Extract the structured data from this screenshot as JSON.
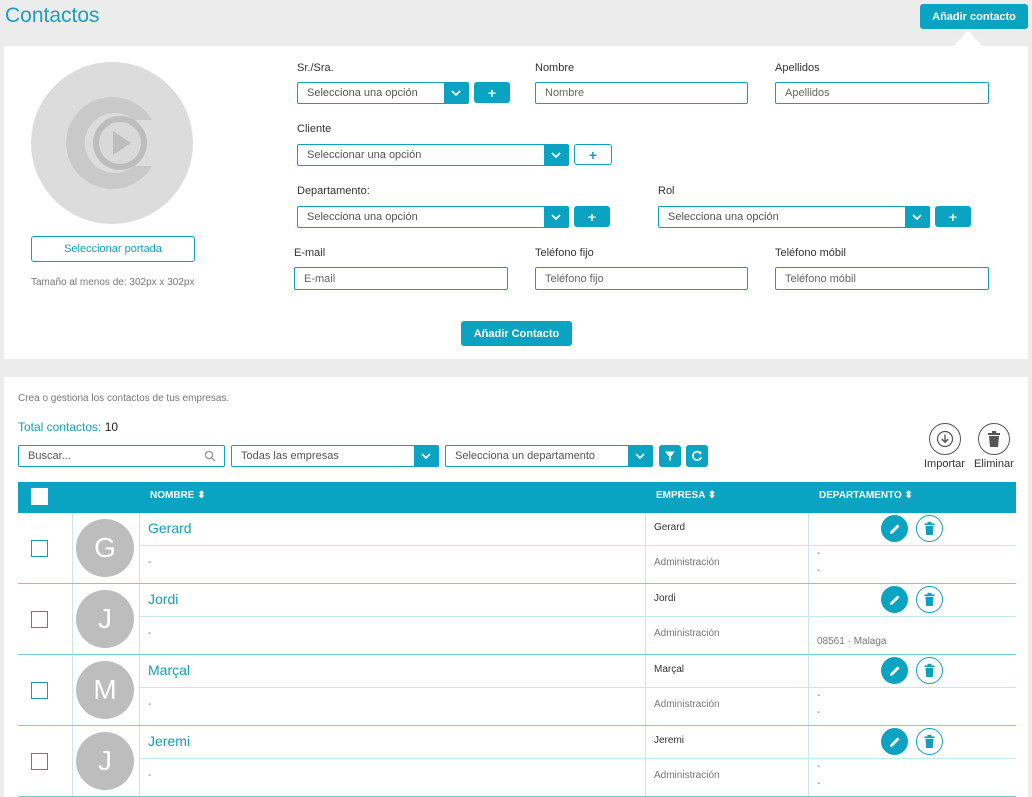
{
  "header": {
    "title": "Contactos",
    "add_button": "Añadir contacto"
  },
  "form": {
    "select_cover": "Seleccionar portada",
    "size_hint": "Tamaño al menos de: 302px x 302px",
    "salutation": {
      "label": "Sr./Sra.",
      "value": "Selecciona una opción"
    },
    "first_name": {
      "label": "Nombre",
      "placeholder": "Nombre"
    },
    "last_name": {
      "label": "Apellidos",
      "placeholder": "Apellidos"
    },
    "client": {
      "label": "Cliente",
      "value": "Seleccionar una opción"
    },
    "department": {
      "label": "Departamento:",
      "value": "Selecciona una opción"
    },
    "role": {
      "label": "Rol",
      "value": "Selecciona una opción"
    },
    "email": {
      "label": "E-mail",
      "placeholder": "E-mail"
    },
    "phone": {
      "label": "Teléfono fijo",
      "placeholder": "Teléfono fijo"
    },
    "mobile": {
      "label": "Teléfono móbil",
      "placeholder": "Teléfono móbil"
    },
    "plus": "+",
    "submit": "Añadir Contacto"
  },
  "list": {
    "description": "Crea o gestiona los contactos de tus empresas.",
    "total_label": "Total contactos:",
    "total_value": "10",
    "search_placeholder": "Buscar...",
    "company_filter": "Todas las empresas",
    "department_filter": "Selecciona un departamento",
    "import_label": "Importar",
    "delete_label": "Eliminar",
    "columns": {
      "name": "NOMBRE",
      "company": "EMPRESA",
      "department": "DEPARTAMENTO"
    },
    "rows": [
      {
        "initial": "G",
        "name": "Gerard",
        "detail": "-",
        "company": "Gerard",
        "dept": "Administración",
        "line1": "-",
        "line2": "-"
      },
      {
        "initial": "J",
        "name": "Jordi",
        "detail": "-",
        "company": "Jordi",
        "dept": "Administración",
        "line1": "",
        "line2": "08561 · Malaga"
      },
      {
        "initial": "M",
        "name": "Marçal",
        "detail": "-",
        "company": "Marçal",
        "dept": "Administración",
        "line1": "-",
        "line2": "-"
      },
      {
        "initial": "J",
        "name": "Jeremi",
        "detail": "-",
        "company": "Jeremi",
        "dept": "Administración",
        "line1": "-",
        "line2": "-"
      }
    ]
  },
  "colors": {
    "accent": "#0ba3c2",
    "avatar": "#bdbdbd",
    "background": "#ececec"
  }
}
